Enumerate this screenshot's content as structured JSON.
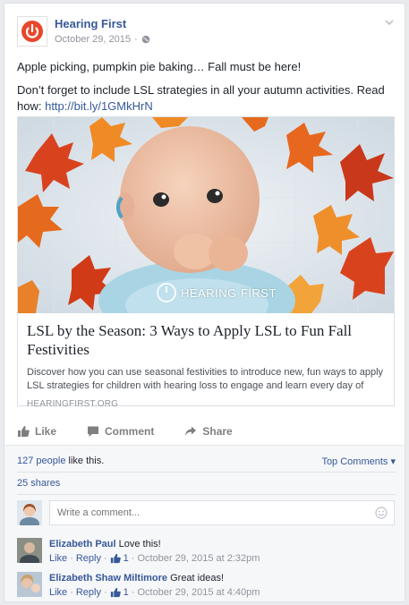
{
  "post": {
    "page_name": "Hearing First",
    "date": "October 29, 2015",
    "text_line1": "Apple picking, pumpkin pie baking… Fall must be here!",
    "text_line2": "Don’t forget to include LSL strategies in all your autumn activities. Read how:",
    "text_link": "http://bit.ly/1GMkHrN",
    "icons": {
      "privacy": "globe-icon",
      "menu": "chevron-down-icon"
    }
  },
  "link_card": {
    "image_brand": "HEARING FIRST",
    "title": "LSL by the Season: 3 Ways to Apply LSL to Fun Fall Festivities",
    "description": "Discover how you can use seasonal festivities to introduce new, fun ways to apply LSL strategies for children with hearing loss to engage and learn every day of the…",
    "domain": "HEARINGFIRST.ORG"
  },
  "actions": {
    "like": "Like",
    "comment": "Comment",
    "share": "Share"
  },
  "stats": {
    "likes_count": "127 people",
    "likes_suffix": " like this.",
    "top_comments": "Top Comments ▾",
    "shares": "25 shares"
  },
  "composer": {
    "placeholder": "Write a comment..."
  },
  "comments": [
    {
      "author": "Elizabeth Paul",
      "text": "Love this!",
      "like": "Like",
      "reply": "Reply",
      "likes": "1",
      "timestamp": "October 29, 2015 at 2:32pm"
    },
    {
      "author": "Elizabeth Shaw Miltimore",
      "text": "Great ideas!",
      "like": "Like",
      "reply": "Reply",
      "likes": "1",
      "timestamp": "October 29, 2015 at 4:40pm"
    }
  ],
  "colors": {
    "link": "#365899",
    "brand": "#e8472b",
    "muted": "#90949c"
  }
}
